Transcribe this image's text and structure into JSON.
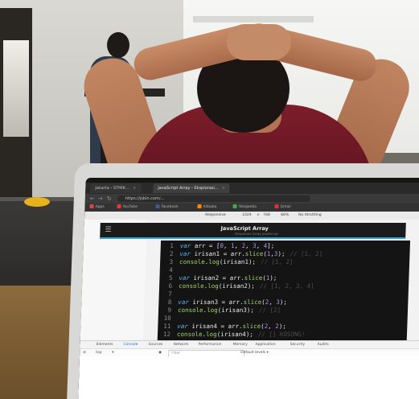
{
  "browser": {
    "tabs": [
      {
        "label": "Jakarta - STMIK...",
        "active": false
      },
      {
        "label": "JavaScript Array - Eksplorasi...",
        "active": true
      }
    ],
    "address": "https://jsbin.com/..."
  },
  "bookmarks": [
    {
      "label": "Apps",
      "color": "#d44"
    },
    {
      "label": "YouTube",
      "color": "#e33"
    },
    {
      "label": "Facebook",
      "color": "#3b5998"
    },
    {
      "label": "Alibaba",
      "color": "#f80"
    },
    {
      "label": "Tokopedia",
      "color": "#4a4"
    },
    {
      "label": "Gmail",
      "color": "#d33"
    }
  ],
  "device_bar": {
    "device": "Responsive",
    "width": "1024",
    "height": "768",
    "zoom": "66%",
    "throttle": "No throttling"
  },
  "page": {
    "title": "JavaScript Array",
    "subtitle": "Eksplorasi Array JavaScript"
  },
  "code_lines": [
    {
      "n": "1",
      "html": "<span class='kw'>var</span> arr = [<span class='num'>0</span>, <span class='num'>1</span>, <span class='num'>2</span>, <span class='num'>3</span>, <span class='num'>4</span>];",
      "comment": ""
    },
    {
      "n": "2",
      "html": "<span class='kw'>var</span> irisan1 = arr.<span class='fn'>slice</span>(<span class='num'>1</span>,<span class='num'>3</span>);",
      "comment": "// [1, 2]"
    },
    {
      "n": "3",
      "html": "<span class='fn'>console</span>.<span class='fn'>log</span>(irisan1);",
      "comment": "// [1, 2]"
    },
    {
      "n": "4",
      "html": "",
      "comment": ""
    },
    {
      "n": "5",
      "html": "<span class='kw'>var</span> irisan2 = arr.<span class='fn'>slice</span>(<span class='num'>1</span>);",
      "comment": ""
    },
    {
      "n": "6",
      "html": "<span class='fn'>console</span>.<span class='fn'>log</span>(irisan2);",
      "comment": "// [1, 2, 3, 4]"
    },
    {
      "n": "7",
      "html": "",
      "comment": ""
    },
    {
      "n": "8",
      "html": "<span class='kw'>var</span> irisan3 = arr.<span class='fn'>slice</span>(<span class='num'>2</span>, <span class='num'>3</span>);",
      "comment": ""
    },
    {
      "n": "9",
      "html": "<span class='fn'>console</span>.<span class='fn'>log</span>(irisan3);",
      "comment": "// [2]"
    },
    {
      "n": "10",
      "html": "",
      "comment": ""
    },
    {
      "n": "11",
      "html": "<span class='kw'>var</span> irisan4 = arr.<span class='fn'>slice</span>(<span class='num'>2</span>, <span class='num'>2</span>);",
      "comment": ""
    },
    {
      "n": "12",
      "html": "<span class='fn'>console</span>.<span class='fn'>log</span>(irisan4);",
      "comment": "// [] KOSONG!"
    }
  ],
  "devtools": {
    "tabs": [
      "Elements",
      "Console",
      "Sources",
      "Network",
      "Performance",
      "Memory",
      "Application",
      "Security",
      "Audits"
    ],
    "active_tab": "Console",
    "context": "top",
    "filter_placeholder": "Filter",
    "levels": "Default levels ▾"
  }
}
